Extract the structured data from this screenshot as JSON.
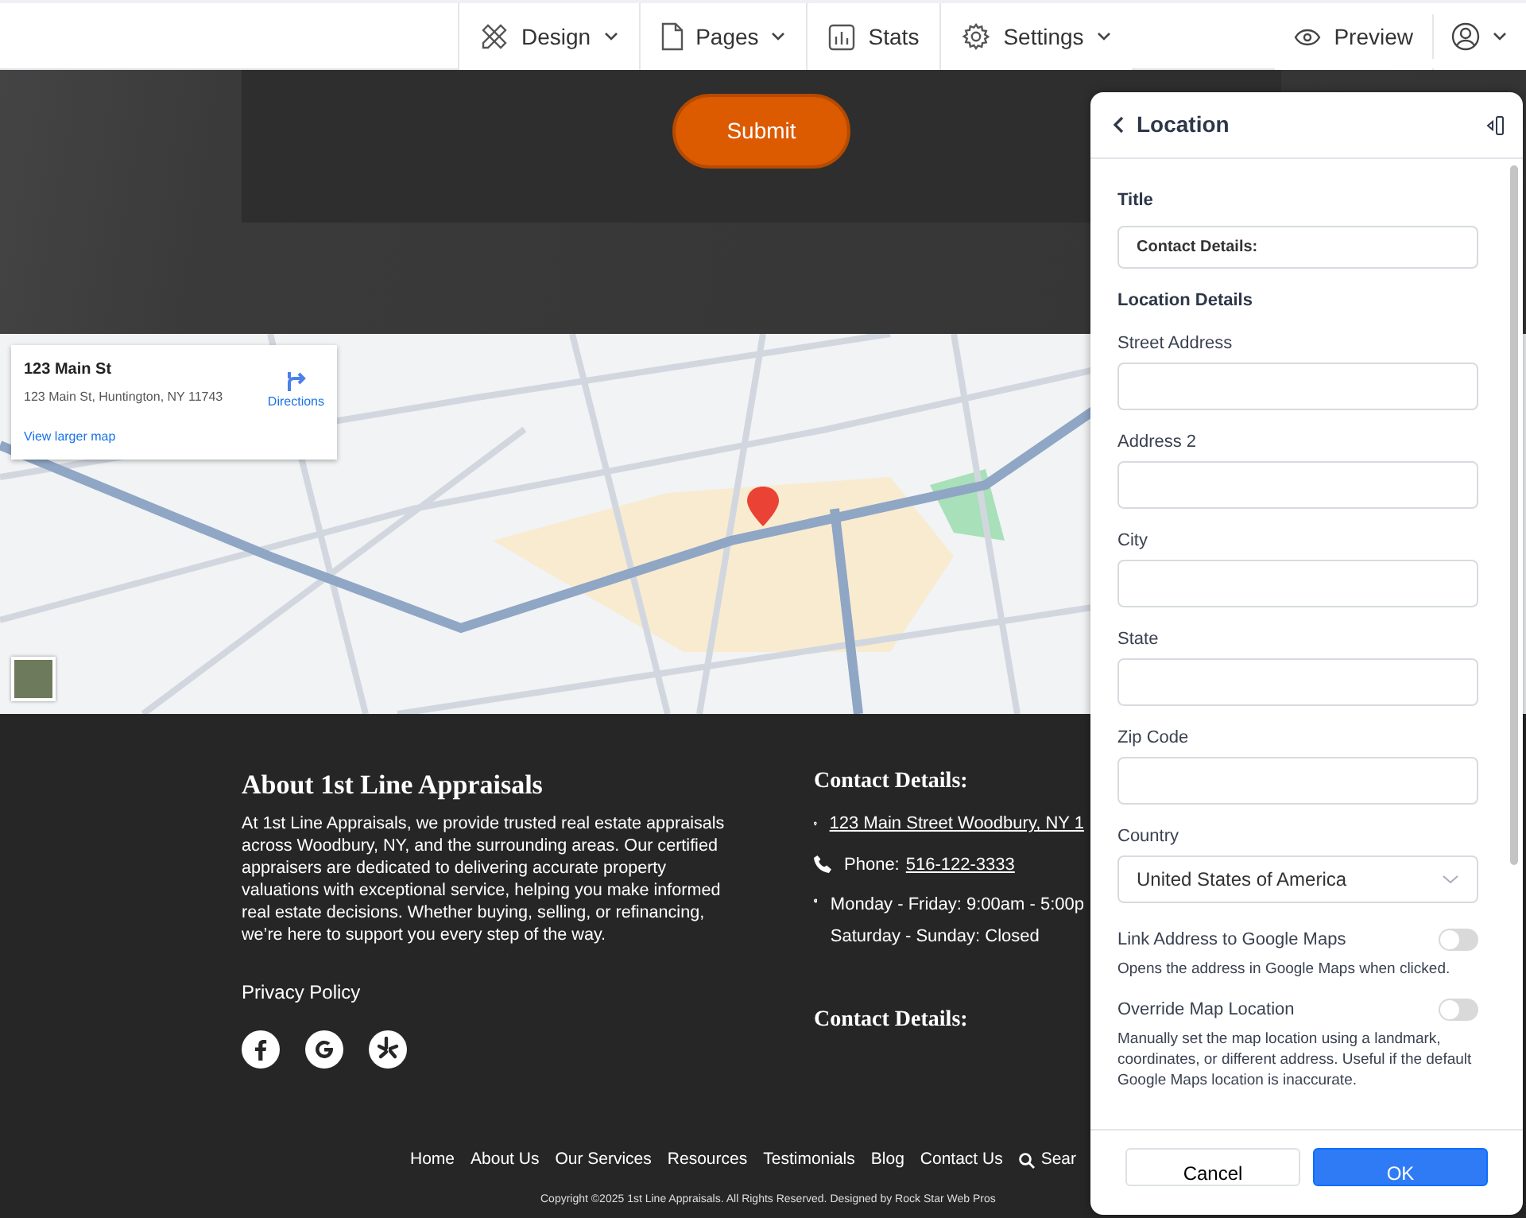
{
  "toolbar": {
    "menus": [
      {
        "label": "Design",
        "kind": "design",
        "dropdown": true
      },
      {
        "label": "Pages",
        "kind": "page",
        "dropdown": true
      },
      {
        "label": "Stats",
        "kind": "stats",
        "dropdown": false
      },
      {
        "label": "Settings",
        "kind": "settings",
        "dropdown": true
      }
    ],
    "preview": "Preview"
  },
  "form_section": {
    "submit": "Submit"
  },
  "map": {
    "card": {
      "title": "123 Main St",
      "address": "123 Main St, Huntington, NY 11743",
      "directions": "Directions",
      "larger_map": "View larger map"
    }
  },
  "footer": {
    "about": {
      "heading": "About 1st Line Appraisals",
      "text": "At 1st Line Appraisals, we provide trusted real estate appraisals across Woodbury, NY, and the surrounding areas. Our certified appraisers are dedicated to delivering accurate property valuations with exceptional service, helping you make informed real estate decisions. Whether buying, selling, or refinancing, we’re here to support you every step of the way.",
      "privacy": "Privacy Policy",
      "social": [
        {
          "kind": "f"
        },
        {
          "kind": "g"
        },
        {
          "kind": "burst"
        }
      ]
    },
    "contact": {
      "heading": "Contact Details:",
      "address": "123 Main Street Woodbury, NY 1",
      "phone_label": "Phone:",
      "phone": "516-122-3333",
      "hours": [
        "Monday - Friday: 9:00am - 5:00p",
        "Saturday - Sunday: Closed"
      ],
      "heading_2": "Contact Details:"
    },
    "nav": [
      {
        "label": "Home"
      },
      {
        "label": "About Us"
      },
      {
        "label": "Our Services"
      },
      {
        "label": "Resources"
      },
      {
        "label": "Testimonials"
      },
      {
        "label": "Blog"
      },
      {
        "label": "Contact Us"
      },
      {
        "label": "Sear",
        "kind": "search"
      }
    ],
    "copyright": "Copyright ©2025 1st Line Appraisals. All Rights Reserved. Designed by Rock Star Web Pros"
  },
  "panel": {
    "title": "Location",
    "title_field": {
      "label": "Title",
      "value": "Contact Details:"
    },
    "section_heading": "Location Details",
    "fields": [
      {
        "label": "Street Address"
      },
      {
        "label": "Address 2"
      },
      {
        "label": "City"
      },
      {
        "label": "State"
      },
      {
        "label": "Zip Code"
      }
    ],
    "country": {
      "label": "Country",
      "value": "United States of America"
    },
    "toggles": [
      {
        "label": "Link Address to Google Maps",
        "description": "Opens the address in Google Maps when clicked.",
        "on": false
      },
      {
        "label": "Override Map Location",
        "description": "Manually set the map location using a landmark, coordinates, or different address. Useful if the default Google Maps location is inaccurate.",
        "on": false
      }
    ],
    "buttons": {
      "cancel": "Cancel",
      "ok": "OK"
    }
  }
}
